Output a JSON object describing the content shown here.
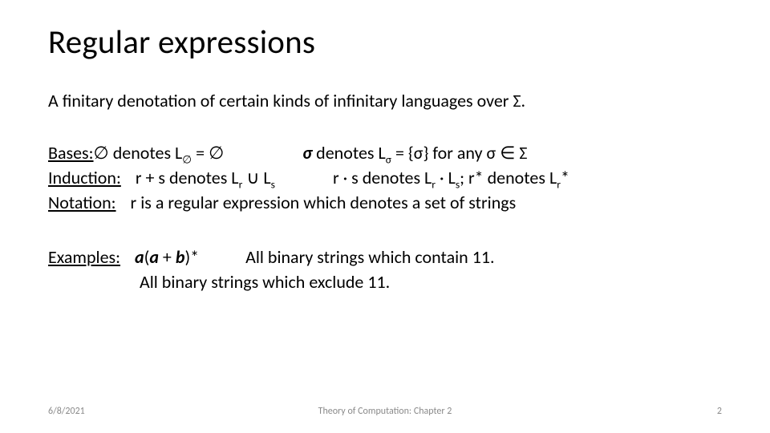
{
  "title": "Regular expressions",
  "subtitle": "A finitary denotation of certain kinds of infinitary languages over Σ.",
  "bases": {
    "label": "Bases:",
    "left_pre": "denotes L",
    "left_post": " = ",
    "sigma_bold": "σ",
    "right": " denotes L",
    "right_post": " = {σ}  for any σ ",
    "right_tail": " Σ"
  },
  "induction": {
    "label": "Induction:",
    "text1_pre": "r + s denotes L",
    "text1_mid": " ",
    "text1_post": " L",
    "text2_pre": "r · s denotes L",
    "text2_mid": " · L",
    "text2_post": "; r* denotes L",
    "text2_tail": "*"
  },
  "notation": {
    "label": "Notation:",
    "text": "r is a regular expression which denotes a set of strings"
  },
  "examples": {
    "label": "Examples:",
    "expr_a1": "a",
    "expr_paren1": "(",
    "expr_a2": "a",
    "expr_plus": " + ",
    "expr_b": "b",
    "expr_paren2": ")*",
    "line1_tail": "All binary strings which contain 11.",
    "line2": "All binary strings which exclude 11."
  },
  "subscripts": {
    "empty": "∅",
    "sigma": "σ",
    "r": "r",
    "s": "s"
  },
  "symbols": {
    "empty": "∅",
    "union": "∪",
    "elem": "∈"
  },
  "footer": {
    "date": "6/8/2021",
    "center": "Theory of Computation: Chapter 2",
    "page": "2"
  }
}
